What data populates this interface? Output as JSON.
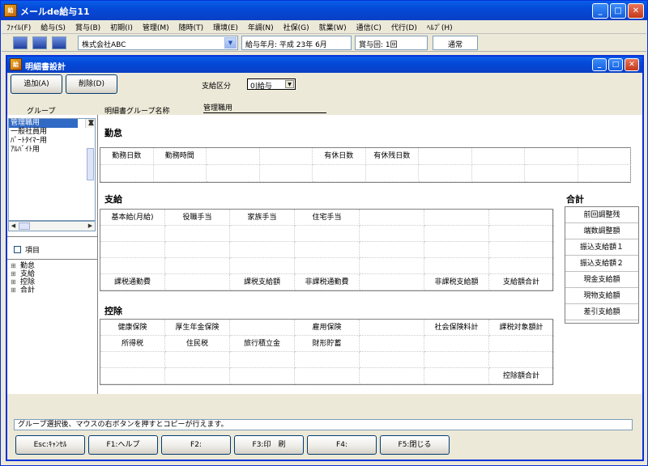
{
  "window": {
    "title": "メールde給与11"
  },
  "menu": [
    "ﾌｧｲﾙ(F)",
    "給与(S)",
    "賞与(B)",
    "初期(I)",
    "管理(M)",
    "随時(T)",
    "環境(E)",
    "年調(N)",
    "社保(G)",
    "就業(W)",
    "通信(C)",
    "代行(D)",
    "ﾍﾙﾌﾟ(H)"
  ],
  "toolbar": {
    "company": "株式会社ABC",
    "pay_period": "給与年月: 平成 23年  6月",
    "bonus_round": "賞与回: 1回",
    "mode": "通常"
  },
  "child": {
    "title": "明細書設計"
  },
  "top": {
    "add_label": "追加(A)",
    "delete_label": "削除(D)",
    "pay_type_label": "支給区分",
    "pay_type_value": "0|給与",
    "group_label": "グループ",
    "group_name_label": "明細書グループ名称",
    "group_name_value": "管理職用"
  },
  "groups": [
    "管理職用",
    "一般社員用",
    "ﾊﾟｰﾄﾀｲﾏｰ用",
    "ｱﾙﾊﾞｲﾄ用"
  ],
  "item_checkbox_label": "項目",
  "tree": [
    "勤怠",
    "支給",
    "控除",
    "合計"
  ],
  "sections": {
    "attendance": {
      "title": "勤怠",
      "cells": [
        "勤務日数",
        "勤務時間",
        "",
        "",
        "有休日数",
        "有休残日数",
        "",
        "",
        "",
        ""
      ]
    },
    "payment": {
      "title": "支給",
      "row1": [
        "基本給(月給)",
        "役職手当",
        "家族手当",
        "住宅手当",
        "",
        "",
        "",
        ""
      ],
      "row_last": [
        "課税通勤費",
        "",
        "課税支給額",
        "非課税通勤費",
        "",
        "非課税支給額",
        "支給額合計",
        ""
      ]
    },
    "deduction": {
      "title": "控除",
      "row1": [
        "健康保険",
        "厚生年金保険",
        "",
        "雇用保険",
        "",
        "社会保険料計",
        "課税対象額計",
        ""
      ],
      "row2": [
        "所得税",
        "住民税",
        "旅行積立金",
        "財形貯蓄",
        "",
        "",
        "",
        ""
      ],
      "row_last": [
        "",
        "",
        "",
        "",
        "",
        "",
        "控除額合計",
        ""
      ]
    },
    "totals": {
      "title": "合計",
      "items": [
        "前回調整残",
        "端数調整額",
        "振込支給額１",
        "振込支給額２",
        "現金支給額",
        "現物支給額",
        "差引支給額"
      ]
    }
  },
  "status_text": "グループ選択後、マウスの右ボタンを押すとコピーが行えます。",
  "fkeys": [
    "Esc:ｷｬﾝｾﾙ",
    "F1:ヘルプ",
    "F2:",
    "F3:印　刷",
    "F4:",
    "F5:閉じる"
  ]
}
